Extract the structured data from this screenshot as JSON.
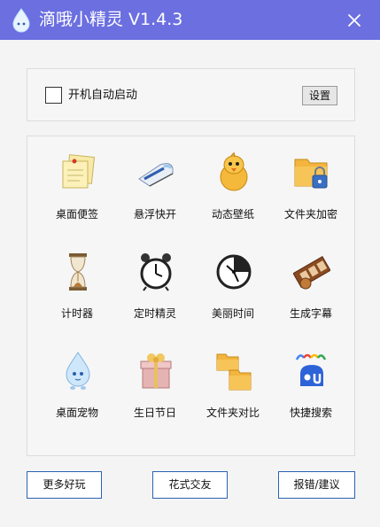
{
  "window": {
    "title": "滴哦小精灵 V1.4.3",
    "titlebar_color": "#6b6fe0"
  },
  "settings": {
    "autostart_label": "开机自动启动",
    "autostart_checked": false,
    "settings_button": "设置"
  },
  "tools": [
    {
      "label": "桌面便签",
      "icon": "sticky-notes-icon"
    },
    {
      "label": "悬浮快开",
      "icon": "bullet-train-icon"
    },
    {
      "label": "动态壁纸",
      "icon": "yellow-bird-icon"
    },
    {
      "label": "文件夹加密",
      "icon": "folder-lock-icon"
    },
    {
      "label": "计时器",
      "icon": "hourglass-icon"
    },
    {
      "label": "定时精灵",
      "icon": "alarm-clock-icon"
    },
    {
      "label": "美丽时间",
      "icon": "clock-face-icon"
    },
    {
      "label": "生成字幕",
      "icon": "film-strip-icon"
    },
    {
      "label": "桌面宠物",
      "icon": "water-drop-pet-icon"
    },
    {
      "label": "生日节日",
      "icon": "gift-box-icon"
    },
    {
      "label": "文件夹对比",
      "icon": "folders-compare-icon"
    },
    {
      "label": "快捷搜索",
      "icon": "search-engine-icon"
    }
  ],
  "footer": {
    "more_fun": "更多好玩",
    "fancy_friends": "花式交友",
    "report": "报错/建议"
  },
  "colors": {
    "accent": "#6b6fe0",
    "button_border": "#2b63b3"
  }
}
